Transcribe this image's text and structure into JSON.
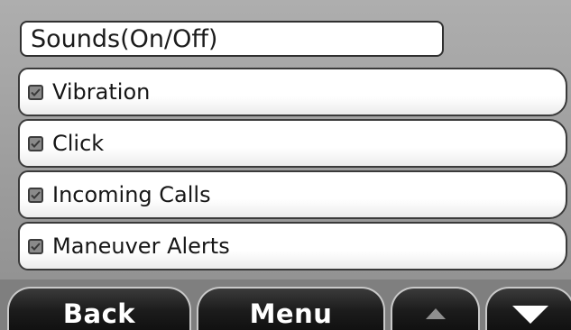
{
  "header": {
    "title": "Sounds(On/Off)"
  },
  "settings": [
    {
      "label": "Vibration",
      "checked": true
    },
    {
      "label": "Click",
      "checked": true
    },
    {
      "label": "Incoming Calls",
      "checked": true
    },
    {
      "label": "Maneuver Alerts",
      "checked": true
    }
  ],
  "toolbar": {
    "back_label": "Back",
    "menu_label": "Menu",
    "up_icon": "triangle-up",
    "down_icon": "triangle-down"
  },
  "colors": {
    "button_bg": "#111111",
    "row_bg": "#ffffff",
    "screen_bg": "#9c9c9c",
    "up_arrow": "#8f8f8f",
    "down_arrow": "#ffffff"
  }
}
